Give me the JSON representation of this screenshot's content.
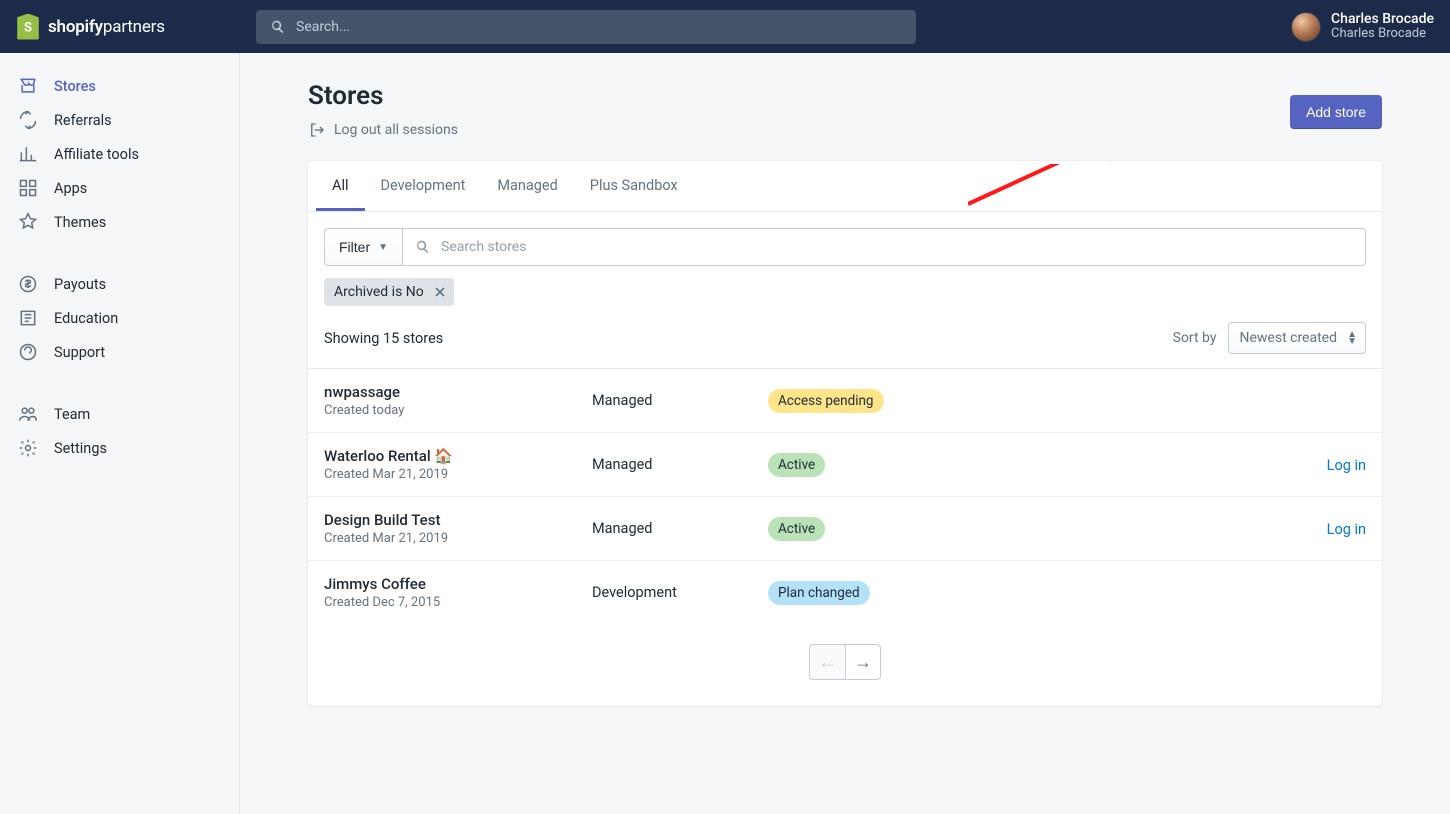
{
  "brand": {
    "name": "shopify",
    "suffix": "partners"
  },
  "search": {
    "placeholder": "Search..."
  },
  "user": {
    "name": "Charles Brocade",
    "org": "Charles Brocade"
  },
  "sidebar": {
    "primary": [
      {
        "label": "Stores"
      },
      {
        "label": "Referrals"
      },
      {
        "label": "Affiliate tools"
      },
      {
        "label": "Apps"
      },
      {
        "label": "Themes"
      }
    ],
    "secondary": [
      {
        "label": "Payouts"
      },
      {
        "label": "Education"
      },
      {
        "label": "Support"
      }
    ],
    "tertiary": [
      {
        "label": "Team"
      },
      {
        "label": "Settings"
      }
    ]
  },
  "page": {
    "title": "Stores",
    "logout_all": "Log out all sessions",
    "add_store": "Add store"
  },
  "tabs": [
    {
      "label": "All"
    },
    {
      "label": "Development"
    },
    {
      "label": "Managed"
    },
    {
      "label": "Plus Sandbox"
    }
  ],
  "filter": {
    "button": "Filter",
    "search_placeholder": "Search stores"
  },
  "chip": {
    "label": "Archived is No"
  },
  "showing": "Showing 15 stores",
  "sort": {
    "label": "Sort by",
    "value": "Newest created"
  },
  "rows": [
    {
      "name": "nwpassage",
      "created": "Created today",
      "type": "Managed",
      "status": "Access pending",
      "status_kind": "pending",
      "action": ""
    },
    {
      "name": "Waterloo Rental 🏠",
      "created": "Created Mar 21, 2019",
      "type": "Managed",
      "status": "Active",
      "status_kind": "active",
      "action": "Log in"
    },
    {
      "name": "Design Build Test",
      "created": "Created Mar 21, 2019",
      "type": "Managed",
      "status": "Active",
      "status_kind": "active",
      "action": "Log in"
    },
    {
      "name": "Jimmys Coffee",
      "created": "Created Dec 7, 2015",
      "type": "Development",
      "status": "Plan changed",
      "status_kind": "plan",
      "action": ""
    }
  ]
}
